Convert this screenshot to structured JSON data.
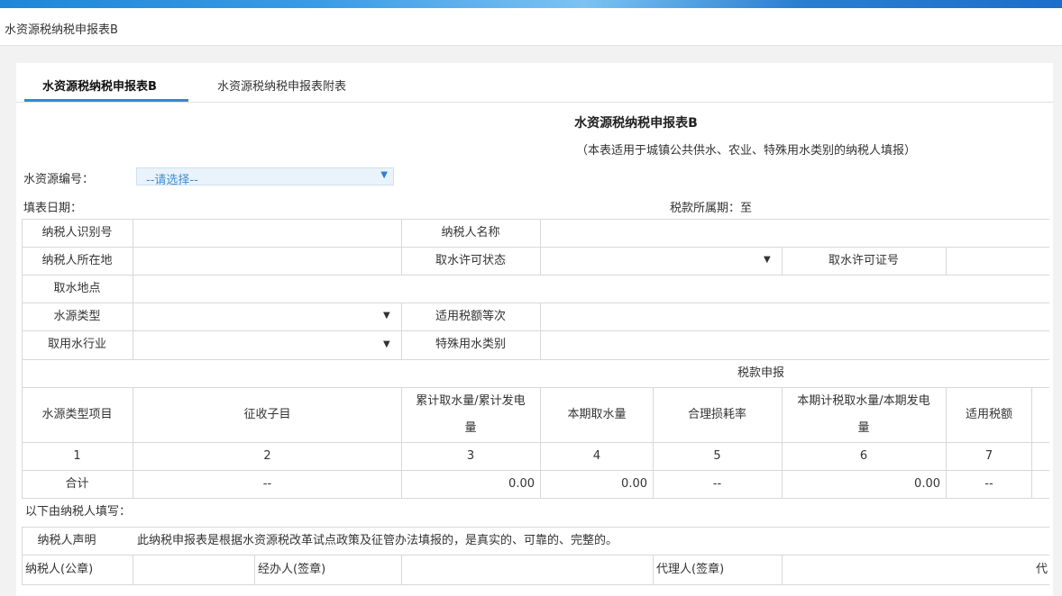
{
  "breadcrumb": "水资源税纳税申报表B",
  "tabs": [
    {
      "label": "水资源税纳税申报表B",
      "active": true
    },
    {
      "label": "水资源税纳税申报表附表",
      "active": false
    }
  ],
  "form": {
    "title": "水资源税纳税申报表B",
    "subtitle": "（本表适用于城镇公共供水、农业、特殊用水类别的纳税人填报）",
    "resource_no_label": "水资源编号：",
    "resource_no_placeholder": "--请选择--",
    "fill_date_label": "填表日期：",
    "tax_period_label": "税款所属期：至"
  },
  "info_table": {
    "taxpayer_id_label": "纳税人识别号",
    "taxpayer_name_label": "纳税人名称",
    "taxpayer_address_label": "纳税人所在地",
    "permit_status_label": "取水许可状态",
    "permit_no_label": "取水许可证号",
    "intake_location_label": "取水地点",
    "water_source_type_label": "水源类型",
    "tax_grade_label": "适用税额等次",
    "industry_label": "取用水行业",
    "special_category_label": "特殊用水类别"
  },
  "tax_table": {
    "section_title": "税款申报",
    "headers": [
      "水源类型项目",
      "征收子目",
      "累计取水量/累计发电量",
      "本期取水量",
      "合理损耗率",
      "本期计税取水量/本期发电量",
      "适用税额"
    ],
    "header_lines_3": [
      "累计取水量/累计发电",
      "量"
    ],
    "header_lines_6": [
      "本期计税取水量/本期发电",
      "量"
    ],
    "index_row": [
      "1",
      "2",
      "3",
      "4",
      "5",
      "6",
      "7"
    ],
    "total_row": [
      "合计",
      "--",
      "0.00",
      "0.00",
      "--",
      "0.00",
      "--"
    ]
  },
  "declaration": {
    "fill_note": "以下由纳税人填写：",
    "statement_label": "纳税人声明",
    "statement_text": "此纳税申报表是根据水资源税改革试点政策及征管办法填报的，是真实的、可靠的、完整的。",
    "taxpayer_seal_label": "纳税人(公章)",
    "handler_label": "经办人(签章)",
    "agent_label": "代理人(签章)",
    "agent_cut_label": "代"
  },
  "icons": {
    "dropdown": "triangle-down-icon"
  },
  "colors": {
    "accent": "#2d8ad9",
    "select_bg": "#eaf3fc",
    "placeholder": "#3a8fd6"
  }
}
